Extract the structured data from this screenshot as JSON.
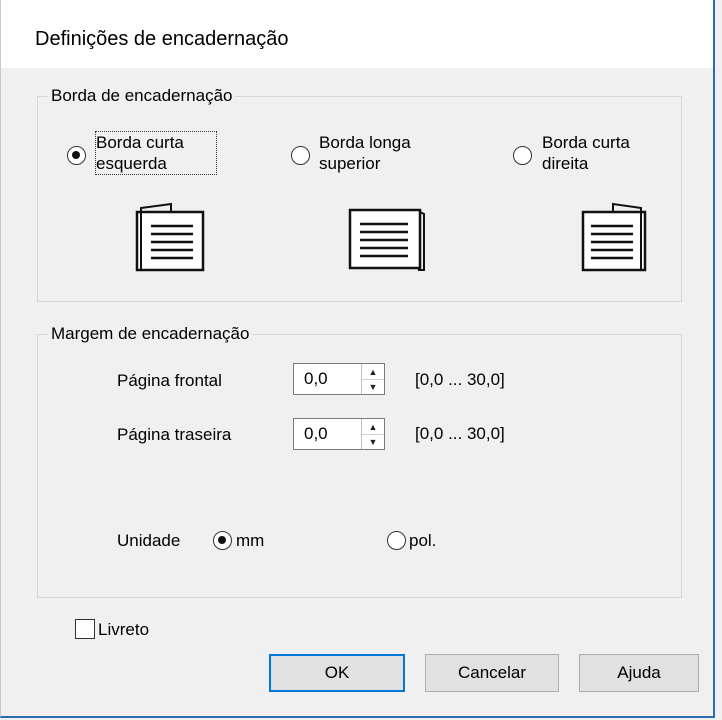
{
  "dialog": {
    "title": "Definições de encadernação"
  },
  "binding_edge": {
    "group_label": "Borda de encadernação",
    "options": [
      {
        "line1": "Borda curta",
        "line2": "esquerda",
        "selected": true
      },
      {
        "line1": "Borda longa",
        "line2": "superior",
        "selected": false
      },
      {
        "line1": "Borda curta",
        "line2": "direita",
        "selected": false
      }
    ]
  },
  "binding_margin": {
    "group_label": "Margem de encadernação",
    "front": {
      "label": "Página frontal",
      "value": "0,0",
      "range": "[0,0 ... 30,0]"
    },
    "back": {
      "label": "Página traseira",
      "value": "0,0",
      "range": "[0,0 ... 30,0]"
    },
    "unit": {
      "label": "Unidade",
      "mm": "mm",
      "inch": "pol.",
      "selected": "mm"
    }
  },
  "booklet": {
    "label": "Livreto",
    "checked": false
  },
  "buttons": {
    "ok": "OK",
    "cancel": "Cancelar",
    "help": "Ajuda"
  }
}
